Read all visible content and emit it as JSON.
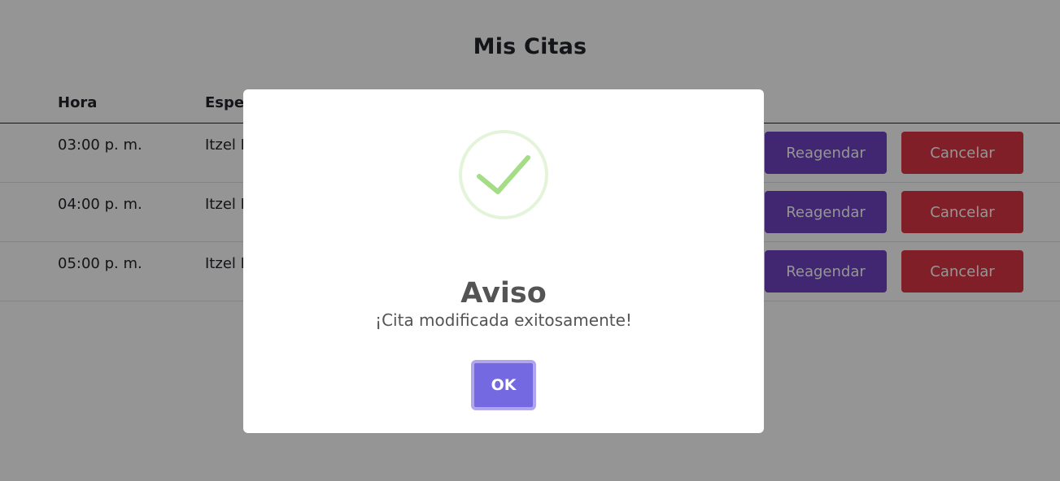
{
  "page": {
    "title": "Mis Citas"
  },
  "table": {
    "headers": [
      "Hora",
      "Espec"
    ],
    "rows": [
      {
        "time": "03:00 p. m.",
        "specialist": "Itzel D",
        "reschedule_label": "Reagendar",
        "cancel_label": "Cancelar"
      },
      {
        "time": "04:00 p. m.",
        "specialist": "Itzel D",
        "reschedule_label": "Reagendar",
        "cancel_label": "Cancelar"
      },
      {
        "time": "05:00 p. m.",
        "specialist": "Itzel D",
        "reschedule_label": "Reagendar",
        "cancel_label": "Cancelar"
      }
    ]
  },
  "modal": {
    "icon": "success-check-icon",
    "title": "Aviso",
    "text": "¡Cita modificada exitosamente!",
    "ok_label": "OK"
  },
  "colors": {
    "reschedule": "#6f42c1",
    "cancel": "#dc3545",
    "confirm": "#7066e0",
    "success": "#a5dc86"
  }
}
